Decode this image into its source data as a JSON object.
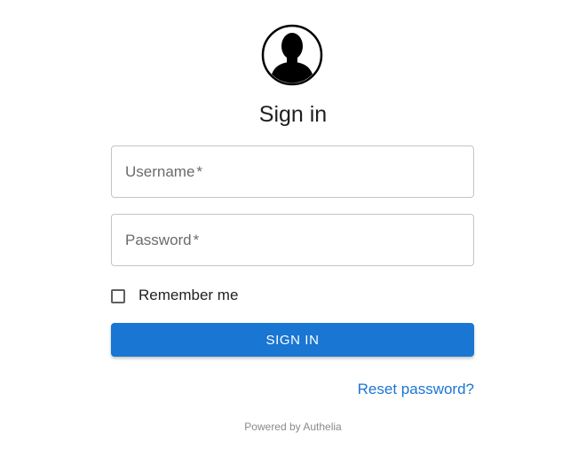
{
  "header": {
    "avatar_icon": "user-silhouette-icon",
    "title": "Sign in"
  },
  "form": {
    "username": {
      "label": "Username",
      "required_mark": "*",
      "value": ""
    },
    "password": {
      "label": "Password",
      "required_mark": "*",
      "value": ""
    },
    "remember_me": {
      "label": "Remember me",
      "checked": false
    },
    "submit_label": "SIGN IN",
    "reset_link": "Reset password?"
  },
  "footer": {
    "text": "Powered by Authelia"
  },
  "colors": {
    "primary": "#1976d2",
    "border": "#c4c4c4",
    "footer_text": "#8a8a8a"
  }
}
